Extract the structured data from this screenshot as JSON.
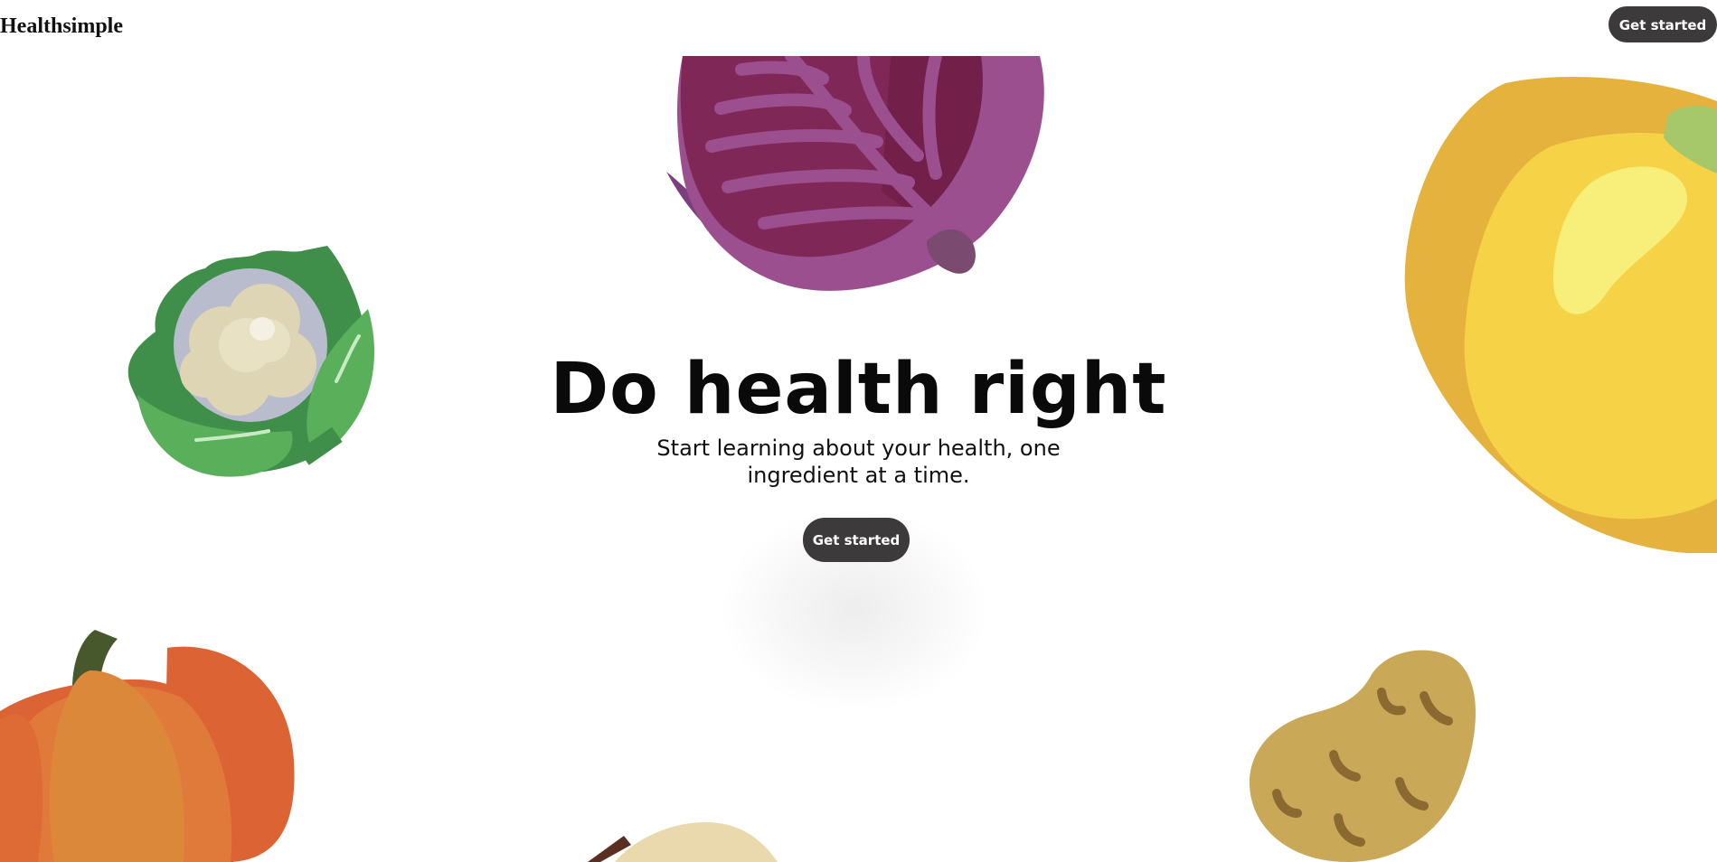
{
  "header": {
    "brand": "Healthsimple",
    "cta_label": "Get started"
  },
  "hero": {
    "title": "Do health right",
    "subtitle": "Start learning about your health, one ingredient at a time.",
    "cta_label": "Get started"
  },
  "illustrations": [
    {
      "name": "red-cabbage-illustration",
      "color": "#7d2b5c"
    },
    {
      "name": "cauliflower-illustration",
      "color": "#5aaf5a"
    },
    {
      "name": "yellow-pepper-illustration",
      "color": "#f5d246"
    },
    {
      "name": "pumpkin-illustration",
      "color": "#dc6434"
    },
    {
      "name": "potato-illustration",
      "color": "#c9a857"
    },
    {
      "name": "mushroom-illustration",
      "color": "#ead9ad"
    }
  ],
  "colors": {
    "button_bg": "#3d3a3b",
    "button_text": "#ffffff",
    "background": "#ffffff"
  }
}
